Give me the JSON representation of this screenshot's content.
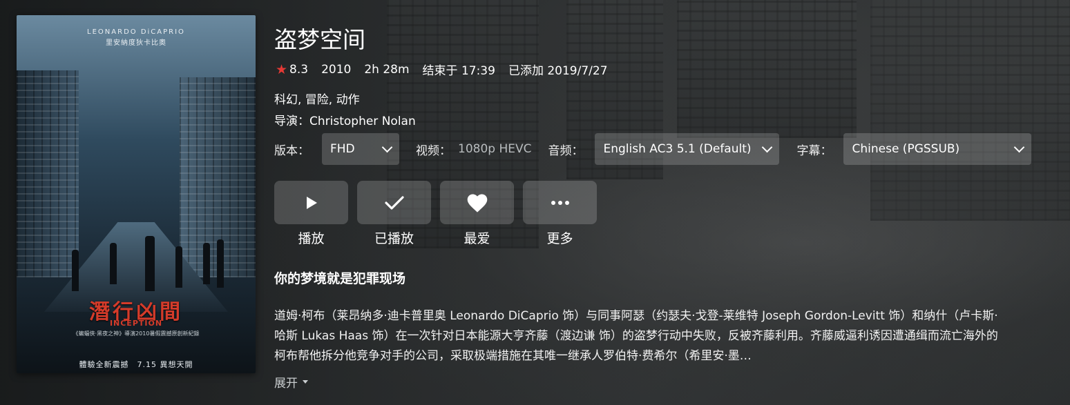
{
  "movie": {
    "title": "盗梦空间",
    "rating": "8.3",
    "year": "2010",
    "runtime": "2h 28m",
    "ends_at": "结束于 17:39",
    "added": "已添加 2019/7/27",
    "genres": "科幻, 冒险, 动作",
    "director_label": "导演：",
    "director": "Christopher Nolan",
    "tagline": "你的梦境就是犯罪现场",
    "overview": "道姆·柯布（莱昂纳多·迪卡普里奥 Leonardo DiCaprio 饰）与同事阿瑟（约瑟夫·戈登-莱维特 Joseph Gordon-Levitt 饰）和纳什（卢卡斯·哈斯 Lukas Haas 饰）在一次针对日本能源大亨齐藤（渡边谦 饰）的盗梦行动中失败，反被齐藤利用。齐藤威逼利诱因遭通缉而流亡海外的柯布帮他拆分他竞争对手的公司，采取极端措施在其唯一继承人罗伯特·费希尔（希里安·墨…",
    "expand_label": "展开"
  },
  "poster": {
    "actor_en": "LEONARDO DiCAPRIO",
    "actor_cn": "里安納度狄卡比奧",
    "title_cn": "潛行凶間",
    "title_en": "INCEPTION",
    "tagline": "《蝙蝠俠·黑夜之神》導演2010暑假震撼原創新紀錄",
    "release": "體驗全新震撼　7.15 異想天開"
  },
  "tracks": {
    "version_label": "版本：",
    "version_value": "FHD",
    "video_label": "视频：",
    "video_value": "1080p HEVC",
    "audio_label": "音频：",
    "audio_value": "English AC3 5.1 (Default)",
    "subtitle_label": "字幕：",
    "subtitle_value": "Chinese (PGSSUB)"
  },
  "actions": {
    "play": "播放",
    "played": "已播放",
    "favorite": "最爱",
    "more": "更多"
  },
  "colors": {
    "star": "#e53935",
    "button_bg": "rgba(255,255,255,0.18)"
  }
}
